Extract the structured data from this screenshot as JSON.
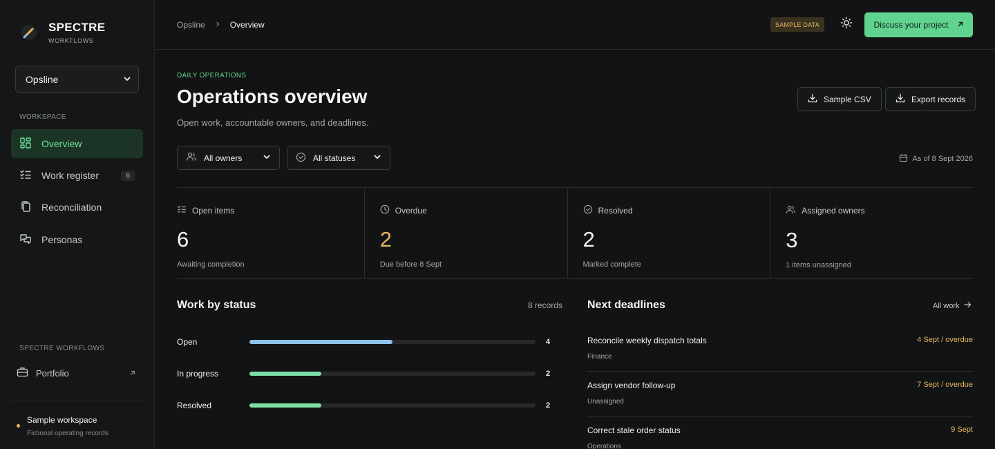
{
  "brand": {
    "name": "SPECTRE",
    "sub": "WORKFLOWS"
  },
  "workspace_select": {
    "value": "Opsline"
  },
  "sidebar": {
    "section_label": "WORKSPACE",
    "items": [
      {
        "label": "Overview",
        "icon": "grid-icon",
        "active": true
      },
      {
        "label": "Work register",
        "icon": "checklist-icon",
        "count": "6"
      },
      {
        "label": "Reconciliation",
        "icon": "copy-icon"
      },
      {
        "label": "Personas",
        "icon": "chat-icon"
      }
    ],
    "footer_label": "SPECTRE WORKFLOWS",
    "portfolio": "Portfolio",
    "sample_ws_title": "Sample workspace",
    "sample_ws_sub": "Fictional operating records"
  },
  "topbar": {
    "crumb_root": "Opsline",
    "crumb_current": "Overview",
    "sample_badge": "SAMPLE DATA",
    "cta": "Discuss your project"
  },
  "header": {
    "eyebrow": "DAILY OPERATIONS",
    "title": "Operations overview",
    "subtitle": "Open work, accountable owners, and deadlines.",
    "sample_csv": "Sample CSV",
    "export": "Export records"
  },
  "filters": {
    "owners": "All owners",
    "statuses": "All statuses",
    "as_of": "As of 8 Sept 2026"
  },
  "stats": [
    {
      "label": "Open items",
      "value": "6",
      "note": "Awaiting completion",
      "icon": "checklist-icon"
    },
    {
      "label": "Overdue",
      "value": "2",
      "note": "Due before 8 Sept",
      "icon": "clock-icon",
      "warn": true
    },
    {
      "label": "Resolved",
      "value": "2",
      "note": "Marked complete",
      "icon": "check-circle-icon"
    },
    {
      "label": "Assigned owners",
      "value": "3",
      "note": "1 items unassigned",
      "icon": "users-icon"
    }
  ],
  "status_panel": {
    "title": "Work by status",
    "records": "8 records",
    "total": 8,
    "rows": [
      {
        "label": "Open",
        "value": 4,
        "color": "#8fc3ec"
      },
      {
        "label": "In progress",
        "value": 2,
        "color": "#7ee0a7"
      },
      {
        "label": "Resolved",
        "value": 2,
        "color": "#7ee0a7"
      }
    ]
  },
  "deadlines_panel": {
    "title": "Next deadlines",
    "all_work": "All work",
    "rows": [
      {
        "title": "Reconcile weekly dispatch totals",
        "owner": "Finance",
        "due": "4 Sept / overdue"
      },
      {
        "title": "Assign vendor follow-up",
        "owner": "Unassigned",
        "due": "7 Sept / overdue"
      },
      {
        "title": "Correct stale order status",
        "owner": "Operations",
        "due": "9 Sept"
      }
    ]
  }
}
